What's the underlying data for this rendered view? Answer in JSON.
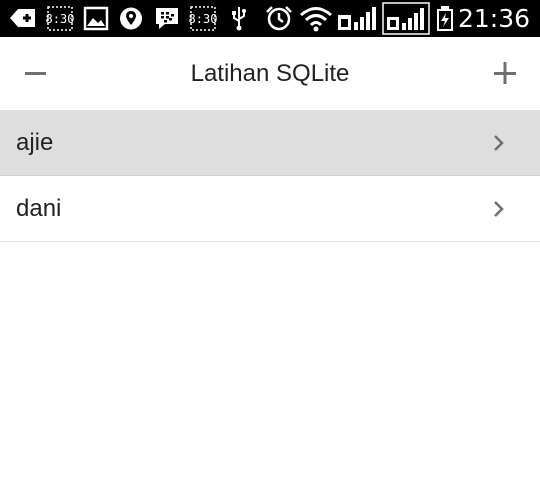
{
  "status_bar": {
    "time": "21:36",
    "notification_icons": [
      "add-message-icon",
      "clock-widget-icon",
      "gallery-icon",
      "maps-icon",
      "bbm-icon",
      "clock-widget-icon",
      "usb-icon",
      "alarm-icon",
      "wifi-icon",
      "signal-icon",
      "signal-icon",
      "battery-charging-icon"
    ]
  },
  "header": {
    "title": "Latihan SQLite",
    "left_icon": "minus-icon",
    "right_icon": "plus-icon"
  },
  "list": {
    "items": [
      {
        "label": "ajie",
        "selected": true
      },
      {
        "label": "dani",
        "selected": false
      }
    ]
  },
  "colors": {
    "status_bar": "#000000",
    "selected_row": "#dedede",
    "text": "#222222",
    "icon_gray": "#6f6f6f"
  }
}
